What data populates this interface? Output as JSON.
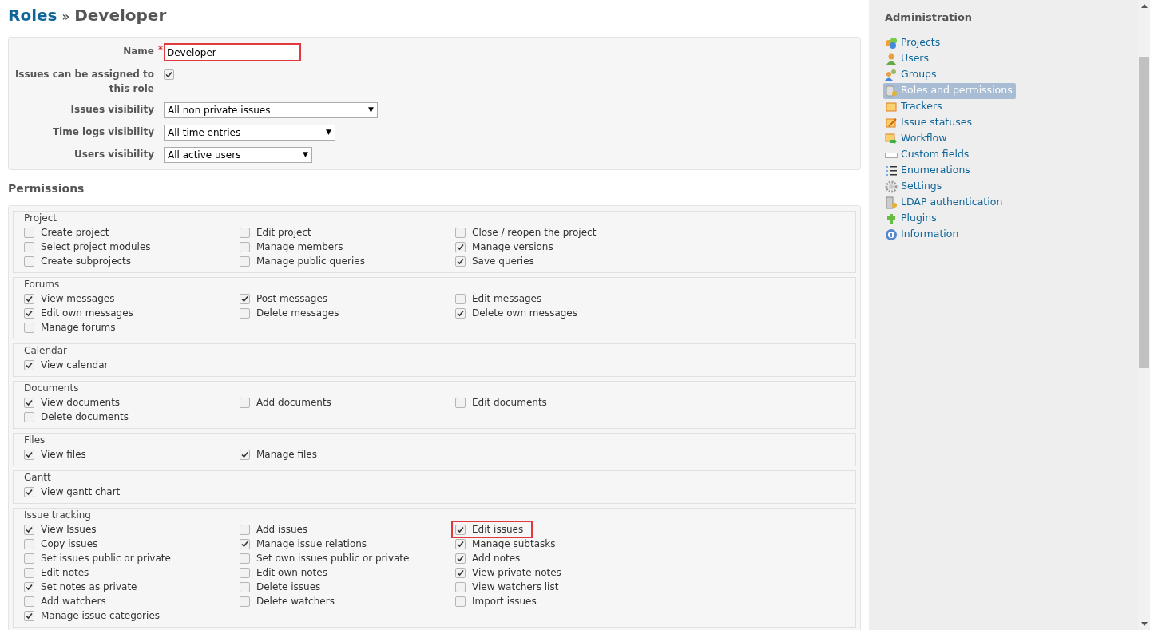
{
  "breadcrumb": {
    "parent": "Roles",
    "separator": "»",
    "current": "Developer"
  },
  "role_form": {
    "fields": [
      {
        "kind": "text",
        "label": "Name",
        "required_mark": "*",
        "value": "Developer",
        "highlighted": true
      },
      {
        "kind": "checkbox",
        "label": "Issues can be assigned to this role",
        "checked": true
      },
      {
        "kind": "select",
        "label": "Issues visibility",
        "value": "All non private issues",
        "arrow": "▼"
      },
      {
        "kind": "select",
        "label": "Time logs visibility",
        "value": "All time entries",
        "arrow": "▼"
      },
      {
        "kind": "select",
        "label": "Users visibility",
        "value": "All active users",
        "arrow": "▼"
      }
    ]
  },
  "permissions": {
    "title": "Permissions",
    "groups": [
      {
        "legend": "Project",
        "items": [
          {
            "label": "Create project",
            "checked": false,
            "highlighted": false
          },
          {
            "label": "Edit project",
            "checked": false,
            "highlighted": false
          },
          {
            "label": "Close / reopen the project",
            "checked": false,
            "highlighted": false
          },
          {
            "label": "Select project modules",
            "checked": false,
            "highlighted": false
          },
          {
            "label": "Manage members",
            "checked": false,
            "highlighted": false
          },
          {
            "label": "Manage versions",
            "checked": true,
            "highlighted": false
          },
          {
            "label": "Create subprojects",
            "checked": false,
            "highlighted": false
          },
          {
            "label": "Manage public queries",
            "checked": false,
            "highlighted": false
          },
          {
            "label": "Save queries",
            "checked": true,
            "highlighted": false
          }
        ]
      },
      {
        "legend": "Forums",
        "items": [
          {
            "label": "View messages",
            "checked": true,
            "highlighted": false
          },
          {
            "label": "Post messages",
            "checked": true,
            "highlighted": false
          },
          {
            "label": "Edit messages",
            "checked": false,
            "highlighted": false
          },
          {
            "label": "Edit own messages",
            "checked": true,
            "highlighted": false
          },
          {
            "label": "Delete messages",
            "checked": false,
            "highlighted": false
          },
          {
            "label": "Delete own messages",
            "checked": true,
            "highlighted": false
          },
          {
            "label": "Manage forums",
            "checked": false,
            "highlighted": false
          }
        ]
      },
      {
        "legend": "Calendar",
        "items": [
          {
            "label": "View calendar",
            "checked": true,
            "highlighted": false
          }
        ]
      },
      {
        "legend": "Documents",
        "items": [
          {
            "label": "View documents",
            "checked": true,
            "highlighted": false
          },
          {
            "label": "Add documents",
            "checked": false,
            "highlighted": false
          },
          {
            "label": "Edit documents",
            "checked": false,
            "highlighted": false
          },
          {
            "label": "Delete documents",
            "checked": false,
            "highlighted": false
          }
        ]
      },
      {
        "legend": "Files",
        "items": [
          {
            "label": "View files",
            "checked": true,
            "highlighted": false
          },
          {
            "label": "Manage files",
            "checked": true,
            "highlighted": false
          }
        ]
      },
      {
        "legend": "Gantt",
        "items": [
          {
            "label": "View gantt chart",
            "checked": true,
            "highlighted": false
          }
        ]
      },
      {
        "legend": "Issue tracking",
        "items": [
          {
            "label": "View Issues",
            "checked": true,
            "highlighted": false
          },
          {
            "label": "Add issues",
            "checked": false,
            "highlighted": false
          },
          {
            "label": "Edit issues",
            "checked": true,
            "highlighted": true
          },
          {
            "label": "Copy issues",
            "checked": false,
            "highlighted": false
          },
          {
            "label": "Manage issue relations",
            "checked": true,
            "highlighted": false
          },
          {
            "label": "Manage subtasks",
            "checked": true,
            "highlighted": false
          },
          {
            "label": "Set issues public or private",
            "checked": false,
            "highlighted": false
          },
          {
            "label": "Set own issues public or private",
            "checked": false,
            "highlighted": false
          },
          {
            "label": "Add notes",
            "checked": true,
            "highlighted": false
          },
          {
            "label": "Edit notes",
            "checked": false,
            "highlighted": false
          },
          {
            "label": "Edit own notes",
            "checked": false,
            "highlighted": false
          },
          {
            "label": "View private notes",
            "checked": true,
            "highlighted": false
          },
          {
            "label": "Set notes as private",
            "checked": true,
            "highlighted": false
          },
          {
            "label": "Delete issues",
            "checked": false,
            "highlighted": false
          },
          {
            "label": "View watchers list",
            "checked": false,
            "highlighted": false
          },
          {
            "label": "Add watchers",
            "checked": false,
            "highlighted": false
          },
          {
            "label": "Delete watchers",
            "checked": false,
            "highlighted": false
          },
          {
            "label": "Import issues",
            "checked": false,
            "highlighted": false
          },
          {
            "label": "Manage issue categories",
            "checked": true,
            "highlighted": false
          }
        ]
      }
    ]
  },
  "sidebar": {
    "title": "Administration",
    "items": [
      {
        "label": "Projects",
        "selected": false
      },
      {
        "label": "Users",
        "selected": false
      },
      {
        "label": "Groups",
        "selected": false
      },
      {
        "label": "Roles and permissions",
        "selected": true
      },
      {
        "label": "Trackers",
        "selected": false
      },
      {
        "label": "Issue statuses",
        "selected": false
      },
      {
        "label": "Workflow",
        "selected": false
      },
      {
        "label": "Custom fields",
        "selected": false
      },
      {
        "label": "Enumerations",
        "selected": false
      },
      {
        "label": "Settings",
        "selected": false
      },
      {
        "label": "LDAP authentication",
        "selected": false
      },
      {
        "label": "Plugins",
        "selected": false
      },
      {
        "label": "Information",
        "selected": false
      }
    ]
  }
}
